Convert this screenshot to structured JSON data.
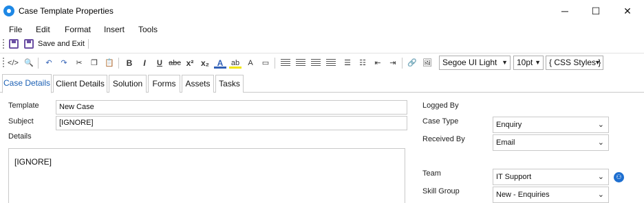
{
  "window": {
    "title": "Case Template Properties",
    "controls": {
      "minimize": "─",
      "maximize": "☐",
      "close": "✕"
    }
  },
  "menu": [
    "File",
    "Edit",
    "Format",
    "Insert",
    "Tools"
  ],
  "quick_access": {
    "save_and_exit_label": "Save and Exit"
  },
  "toolbar": {
    "font_family": "Segoe UI Light",
    "font_size": "10pt",
    "css_styles": "{ CSS Styles }"
  },
  "tabs": [
    "Case Details",
    "Client Details",
    "Solution",
    "Forms",
    "Assets",
    "Tasks"
  ],
  "active_tab": "Case Details",
  "form": {
    "template_label": "Template",
    "template_value": "New Case",
    "subject_label": "Subject",
    "subject_value": "[IGNORE]",
    "details_label": "Details",
    "details_value": "[IGNORE]",
    "logged_by_label": "Logged By",
    "case_type_label": "Case Type",
    "case_type_value": "Enquiry",
    "received_by_label": "Received By",
    "received_by_value": "Email",
    "team_label": "Team",
    "team_value": "IT Support",
    "skill_group_label": "Skill Group",
    "skill_group_value": "New - Enquiries"
  },
  "colors": {
    "accent": "#1a5fb4",
    "save_icon": "#6b4fa3",
    "app_icon": "#1e88e5"
  }
}
